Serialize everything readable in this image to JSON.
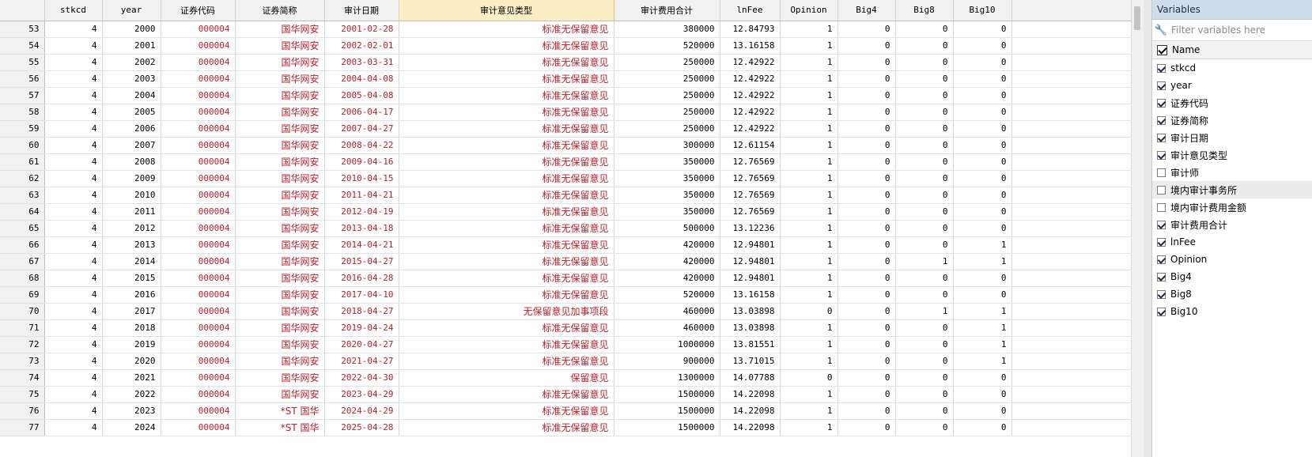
{
  "grid": {
    "columns": [
      "stkcd",
      "year",
      "证券代码",
      "证券简称",
      "审计日期",
      "审计意见类型",
      "审计费用合计",
      "lnFee",
      "Opinion",
      "Big4",
      "Big8",
      "Big10"
    ],
    "active_column": 5,
    "rows": [
      [
        "53",
        "4",
        "2000",
        "000004",
        "国华网安",
        "2001-02-28",
        "标准无保留意见",
        "380000",
        "12.84793",
        "1",
        "0",
        "0",
        "0"
      ],
      [
        "54",
        "4",
        "2001",
        "000004",
        "国华网安",
        "2002-02-01",
        "标准无保留意见",
        "520000",
        "13.16158",
        "1",
        "0",
        "0",
        "0"
      ],
      [
        "55",
        "4",
        "2002",
        "000004",
        "国华网安",
        "2003-03-31",
        "标准无保留意见",
        "250000",
        "12.42922",
        "1",
        "0",
        "0",
        "0"
      ],
      [
        "56",
        "4",
        "2003",
        "000004",
        "国华网安",
        "2004-04-08",
        "标准无保留意见",
        "250000",
        "12.42922",
        "1",
        "0",
        "0",
        "0"
      ],
      [
        "57",
        "4",
        "2004",
        "000004",
        "国华网安",
        "2005-04-08",
        "标准无保留意见",
        "250000",
        "12.42922",
        "1",
        "0",
        "0",
        "0"
      ],
      [
        "58",
        "4",
        "2005",
        "000004",
        "国华网安",
        "2006-04-17",
        "标准无保留意见",
        "250000",
        "12.42922",
        "1",
        "0",
        "0",
        "0"
      ],
      [
        "59",
        "4",
        "2006",
        "000004",
        "国华网安",
        "2007-04-27",
        "标准无保留意见",
        "250000",
        "12.42922",
        "1",
        "0",
        "0",
        "0"
      ],
      [
        "60",
        "4",
        "2007",
        "000004",
        "国华网安",
        "2008-04-22",
        "标准无保留意见",
        "300000",
        "12.61154",
        "1",
        "0",
        "0",
        "0"
      ],
      [
        "61",
        "4",
        "2008",
        "000004",
        "国华网安",
        "2009-04-16",
        "标准无保留意见",
        "350000",
        "12.76569",
        "1",
        "0",
        "0",
        "0"
      ],
      [
        "62",
        "4",
        "2009",
        "000004",
        "国华网安",
        "2010-04-15",
        "标准无保留意见",
        "350000",
        "12.76569",
        "1",
        "0",
        "0",
        "0"
      ],
      [
        "63",
        "4",
        "2010",
        "000004",
        "国华网安",
        "2011-04-21",
        "标准无保留意见",
        "350000",
        "12.76569",
        "1",
        "0",
        "0",
        "0"
      ],
      [
        "64",
        "4",
        "2011",
        "000004",
        "国华网安",
        "2012-04-19",
        "标准无保留意见",
        "350000",
        "12.76569",
        "1",
        "0",
        "0",
        "0"
      ],
      [
        "65",
        "4",
        "2012",
        "000004",
        "国华网安",
        "2013-04-18",
        "标准无保留意见",
        "500000",
        "13.12236",
        "1",
        "0",
        "0",
        "0"
      ],
      [
        "66",
        "4",
        "2013",
        "000004",
        "国华网安",
        "2014-04-21",
        "标准无保留意见",
        "420000",
        "12.94801",
        "1",
        "0",
        "0",
        "1"
      ],
      [
        "67",
        "4",
        "2014",
        "000004",
        "国华网安",
        "2015-04-27",
        "标准无保留意见",
        "420000",
        "12.94801",
        "1",
        "0",
        "1",
        "1"
      ],
      [
        "68",
        "4",
        "2015",
        "000004",
        "国华网安",
        "2016-04-28",
        "标准无保留意见",
        "420000",
        "12.94801",
        "1",
        "0",
        "0",
        "0"
      ],
      [
        "69",
        "4",
        "2016",
        "000004",
        "国华网安",
        "2017-04-10",
        "标准无保留意见",
        "520000",
        "13.16158",
        "1",
        "0",
        "0",
        "0"
      ],
      [
        "70",
        "4",
        "2017",
        "000004",
        "国华网安",
        "2018-04-27",
        "无保留意见加事项段",
        "460000",
        "13.03898",
        "0",
        "0",
        "1",
        "1"
      ],
      [
        "71",
        "4",
        "2018",
        "000004",
        "国华网安",
        "2019-04-24",
        "标准无保留意见",
        "460000",
        "13.03898",
        "1",
        "0",
        "0",
        "1"
      ],
      [
        "72",
        "4",
        "2019",
        "000004",
        "国华网安",
        "2020-04-27",
        "标准无保留意见",
        "1000000",
        "13.81551",
        "1",
        "0",
        "0",
        "1"
      ],
      [
        "73",
        "4",
        "2020",
        "000004",
        "国华网安",
        "2021-04-27",
        "标准无保留意见",
        "900000",
        "13.71015",
        "1",
        "0",
        "0",
        "1"
      ],
      [
        "74",
        "4",
        "2021",
        "000004",
        "国华网安",
        "2022-04-30",
        "保留意见",
        "1300000",
        "14.07788",
        "0",
        "0",
        "0",
        "0"
      ],
      [
        "75",
        "4",
        "2022",
        "000004",
        "国华网安",
        "2023-04-29",
        "标准无保留意见",
        "1500000",
        "14.22098",
        "1",
        "0",
        "0",
        "0"
      ],
      [
        "76",
        "4",
        "2023",
        "000004",
        "*ST 国华",
        "2024-04-29",
        "标准无保留意见",
        "1500000",
        "14.22098",
        "1",
        "0",
        "0",
        "0"
      ],
      [
        "77",
        "4",
        "2024",
        "000004",
        "*ST 国华",
        "2025-04-28",
        "标准无保留意见",
        "1500000",
        "14.22098",
        "1",
        "0",
        "0",
        "0"
      ]
    ],
    "string_color": "#b8202b"
  },
  "variables": {
    "title": "Variables",
    "filter_placeholder": "Filter variables here",
    "name_header": "Name",
    "items": [
      {
        "name": "stkcd",
        "checked": true
      },
      {
        "name": "year",
        "checked": true
      },
      {
        "name": "证券代码",
        "checked": true
      },
      {
        "name": "证券简称",
        "checked": true
      },
      {
        "name": "审计日期",
        "checked": true
      },
      {
        "name": "审计意见类型",
        "checked": true
      },
      {
        "name": "审计师",
        "checked": false
      },
      {
        "name": "境内审计事务所",
        "checked": false,
        "highlighted": true
      },
      {
        "name": "境内审计费用金额",
        "checked": false
      },
      {
        "name": "审计费用合计",
        "checked": true
      },
      {
        "name": "lnFee",
        "checked": true
      },
      {
        "name": "Opinion",
        "checked": true
      },
      {
        "name": "Big4",
        "checked": true
      },
      {
        "name": "Big8",
        "checked": true
      },
      {
        "name": "Big10",
        "checked": true
      }
    ]
  }
}
